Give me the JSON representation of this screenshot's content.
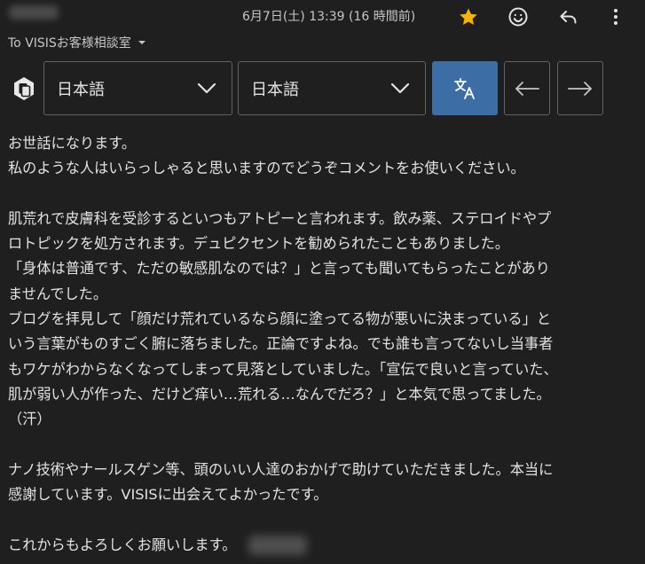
{
  "header": {
    "date": "6月7日(土) 13:39 (16 時間前)",
    "recipient": "To VISISお客様相談室",
    "icons": [
      "star-icon",
      "emoji-icon",
      "reply-icon",
      "more-vert-icon"
    ],
    "star_color": "#f5b400"
  },
  "translate_bar": {
    "source_language": "日本語",
    "target_language": "日本語",
    "accent_color": "#3c6ea5"
  },
  "body": {
    "lines": [
      "お世話になります。",
      "私のような人はいらっしゃると思いますのでどうぞコメントをお使いください。",
      "",
      "肌荒れで皮膚科を受診するといつもアトピーと言われます。飲み薬、ステロイドやプ",
      "ロトピックを処方されます。デュピクセントを勧められたこともありました。",
      "「身体は普通です、ただの敏感肌なのでは？」と言っても聞いてもらったことがあり",
      "ませんでした。",
      "ブログを拝見して「顔だけ荒れているなら顔に塗ってる物が悪いに決まっている」と",
      "いう言葉がものすごく腑に落ちました。正論ですよね。でも誰も言ってないし当事者",
      "もワケがわからなくなってしまって見落としていました。「宣伝で良いと言っていた、",
      "肌が弱い人が作った、だけど痒い…荒れる…なんでだろ？」と本気で思ってました。",
      "（汗）",
      "",
      "ナノ技術やナールスゲン等、頭のいい人達のおかげで助けていただきました。本当に",
      "感謝しています。VISISに出会えてよかったです。",
      "",
      "これからもよろしくお願いします。"
    ]
  }
}
